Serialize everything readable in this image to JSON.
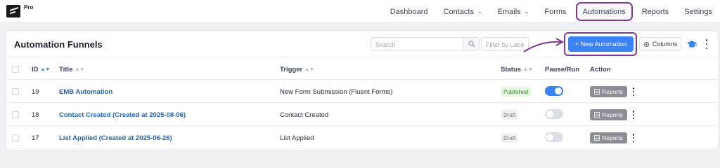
{
  "app": {
    "logo_label": "Pro"
  },
  "nav": {
    "items": [
      {
        "label": "Dashboard",
        "dropdown": false
      },
      {
        "label": "Contacts",
        "dropdown": true
      },
      {
        "label": "Emails",
        "dropdown": true
      },
      {
        "label": "Forms",
        "dropdown": false
      },
      {
        "label": "Automations",
        "dropdown": false,
        "highlighted": true
      },
      {
        "label": "Reports",
        "dropdown": false
      },
      {
        "label": "Settings",
        "dropdown": false
      }
    ]
  },
  "page": {
    "title": "Automation Funnels",
    "search_placeholder": "Search",
    "filter_placeholder": "Filter by Labels",
    "new_button": "+ New Automation",
    "columns_button": "Columns"
  },
  "table": {
    "headers": {
      "id": "ID",
      "title": "Title",
      "trigger": "Trigger",
      "status": "Status",
      "pause_run": "Pause/Run",
      "action": "Action"
    },
    "action_label": "Reports",
    "rows": [
      {
        "id": "19",
        "title": "EMB Automation",
        "trigger": "New Form Submission (Fluent Forms)",
        "status": "Published",
        "running": true
      },
      {
        "id": "18",
        "title": "Contact Created (Created at 2025-08-06)",
        "trigger": "Contact Created",
        "status": "Draft",
        "running": false
      },
      {
        "id": "17",
        "title": "List Applied (Created at 2025-06-26)",
        "trigger": "List Applied",
        "status": "Draft",
        "running": false
      }
    ]
  },
  "icons": {
    "search": "search-icon",
    "columns": "gear-icon",
    "help": "graduation-cap-icon",
    "more": "more-vertical-icon",
    "reports": "chart-icon"
  },
  "colors": {
    "primary": "#3b82f6",
    "highlight": "#7b3a8f",
    "link": "#2563a8",
    "published_bg": "#e7f6e3",
    "published_text": "#3b8a2b"
  }
}
